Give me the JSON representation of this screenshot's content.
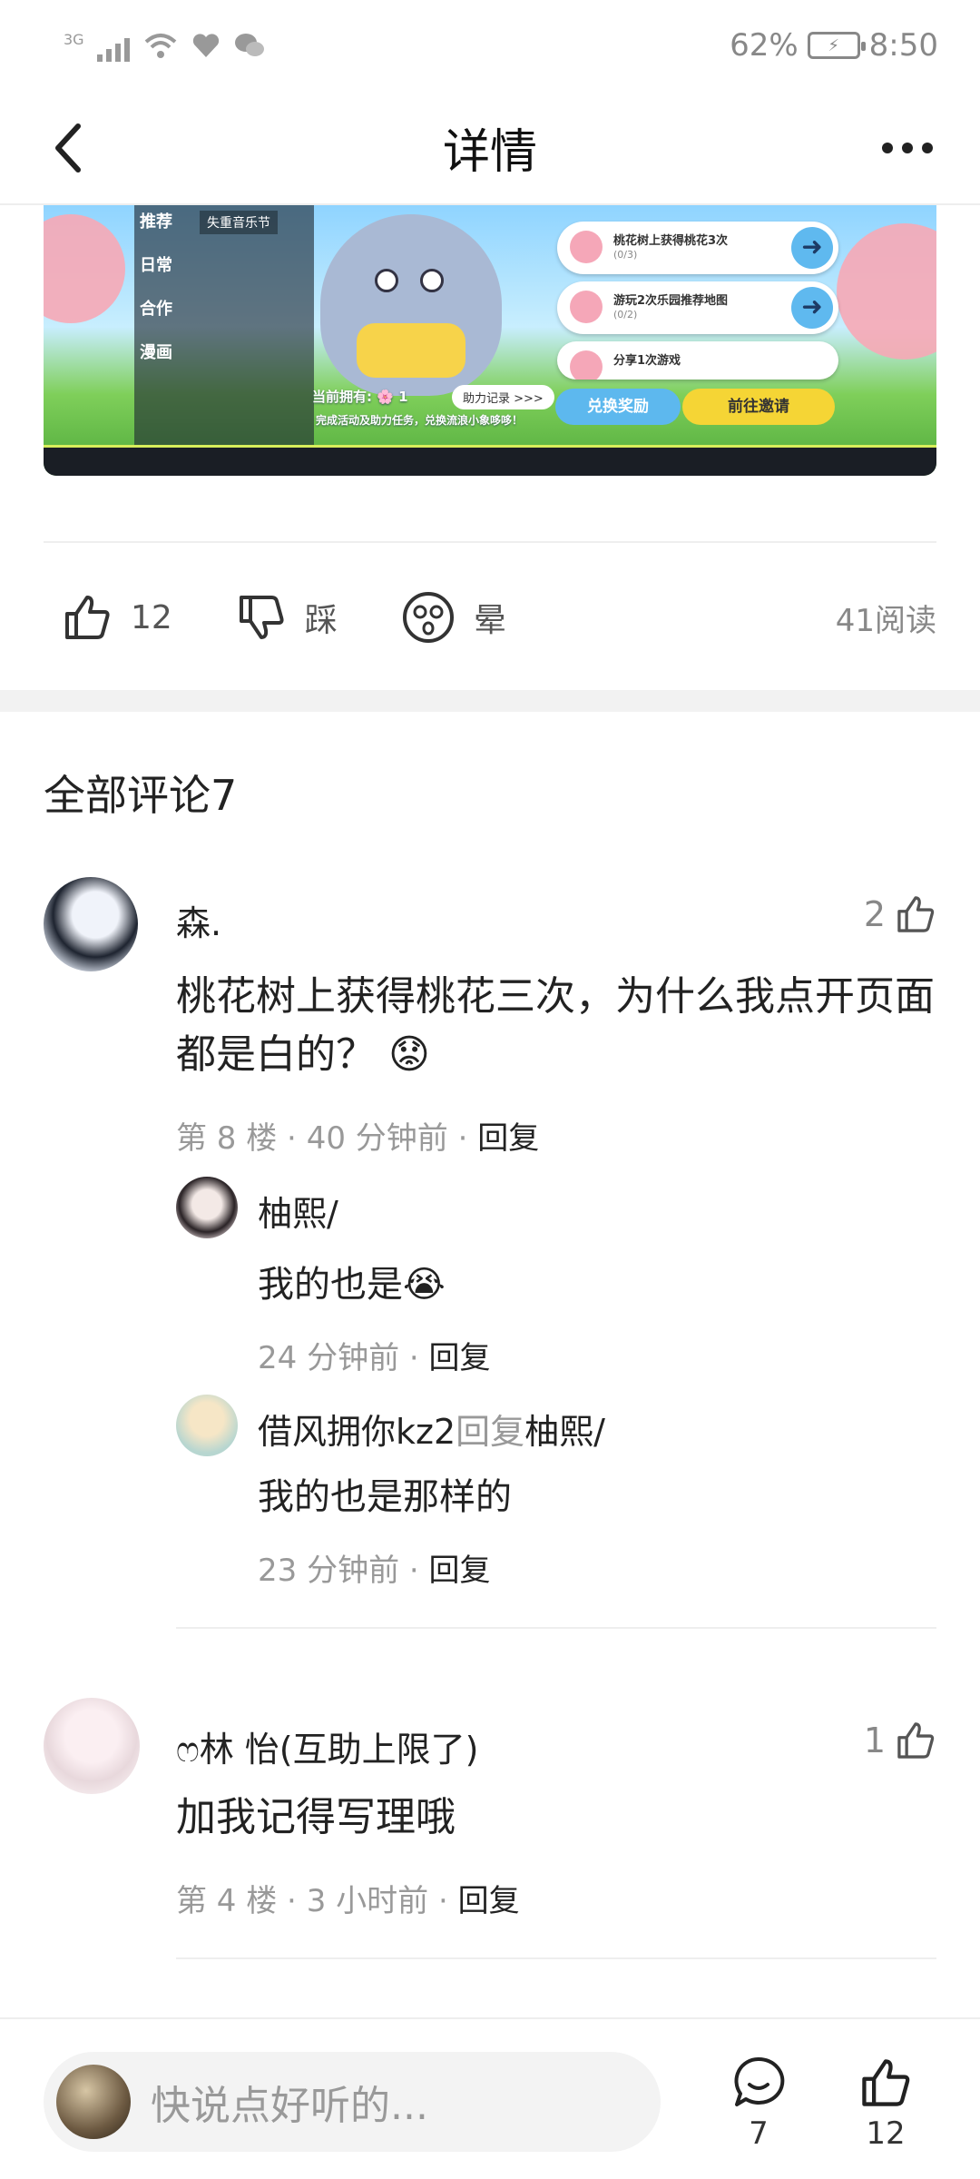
{
  "status_bar": {
    "network": "3G",
    "battery": "62%",
    "time": "8:50"
  },
  "header": {
    "title": "详情"
  },
  "banner": {
    "menu": [
      "推荐",
      "日常",
      "合作",
      "漫画"
    ],
    "festival_tag": "失重音乐节",
    "tasks": [
      {
        "title": "桃花树上获得桃花3次",
        "progress": "(0/3)"
      },
      {
        "title": "游玩2次乐园推荐地图",
        "progress": "(0/2)"
      },
      {
        "title": "分享1次游戏",
        "progress": ""
      }
    ],
    "owned_label": "当前拥有:",
    "owned_count": "1",
    "help_record": "助力记录 >>>",
    "notice": "完成活动及助力任务，兑换流浪小象哆哆！",
    "exchange_label": "兑换奖励",
    "invite_label": "前往邀请"
  },
  "reactions": {
    "like_count": "12",
    "dislike_label": "踩",
    "dizzy_label": "晕",
    "reads": "41阅读"
  },
  "comments_title": "全部评论7",
  "comments": [
    {
      "name": "森.",
      "likes": "2",
      "text": "桃花树上获得桃花三次，为什么我点开页面都是白的？ 😟",
      "floor": "第 8 楼",
      "time": "40 分钟前",
      "reply": "回复",
      "replies": [
        {
          "name": "柚熙/",
          "text": "我的也是😭",
          "time": "24 分钟前",
          "reply": "回复"
        },
        {
          "name": "借风拥你kz2",
          "reply_word": "回复",
          "reply_to": "柚熙/",
          "text": "我的也是那样的",
          "time": "23 分钟前",
          "reply": "回复"
        }
      ]
    },
    {
      "name": "ෆ林 怡(互助上限了)",
      "likes": "1",
      "text": "加我记得写理哦",
      "floor": "第 4 楼",
      "time": "3 小时前",
      "reply": "回复"
    }
  ],
  "bottom_bar": {
    "input_placeholder": "快说点好听的...",
    "comment_count": "7",
    "like_count": "12"
  }
}
